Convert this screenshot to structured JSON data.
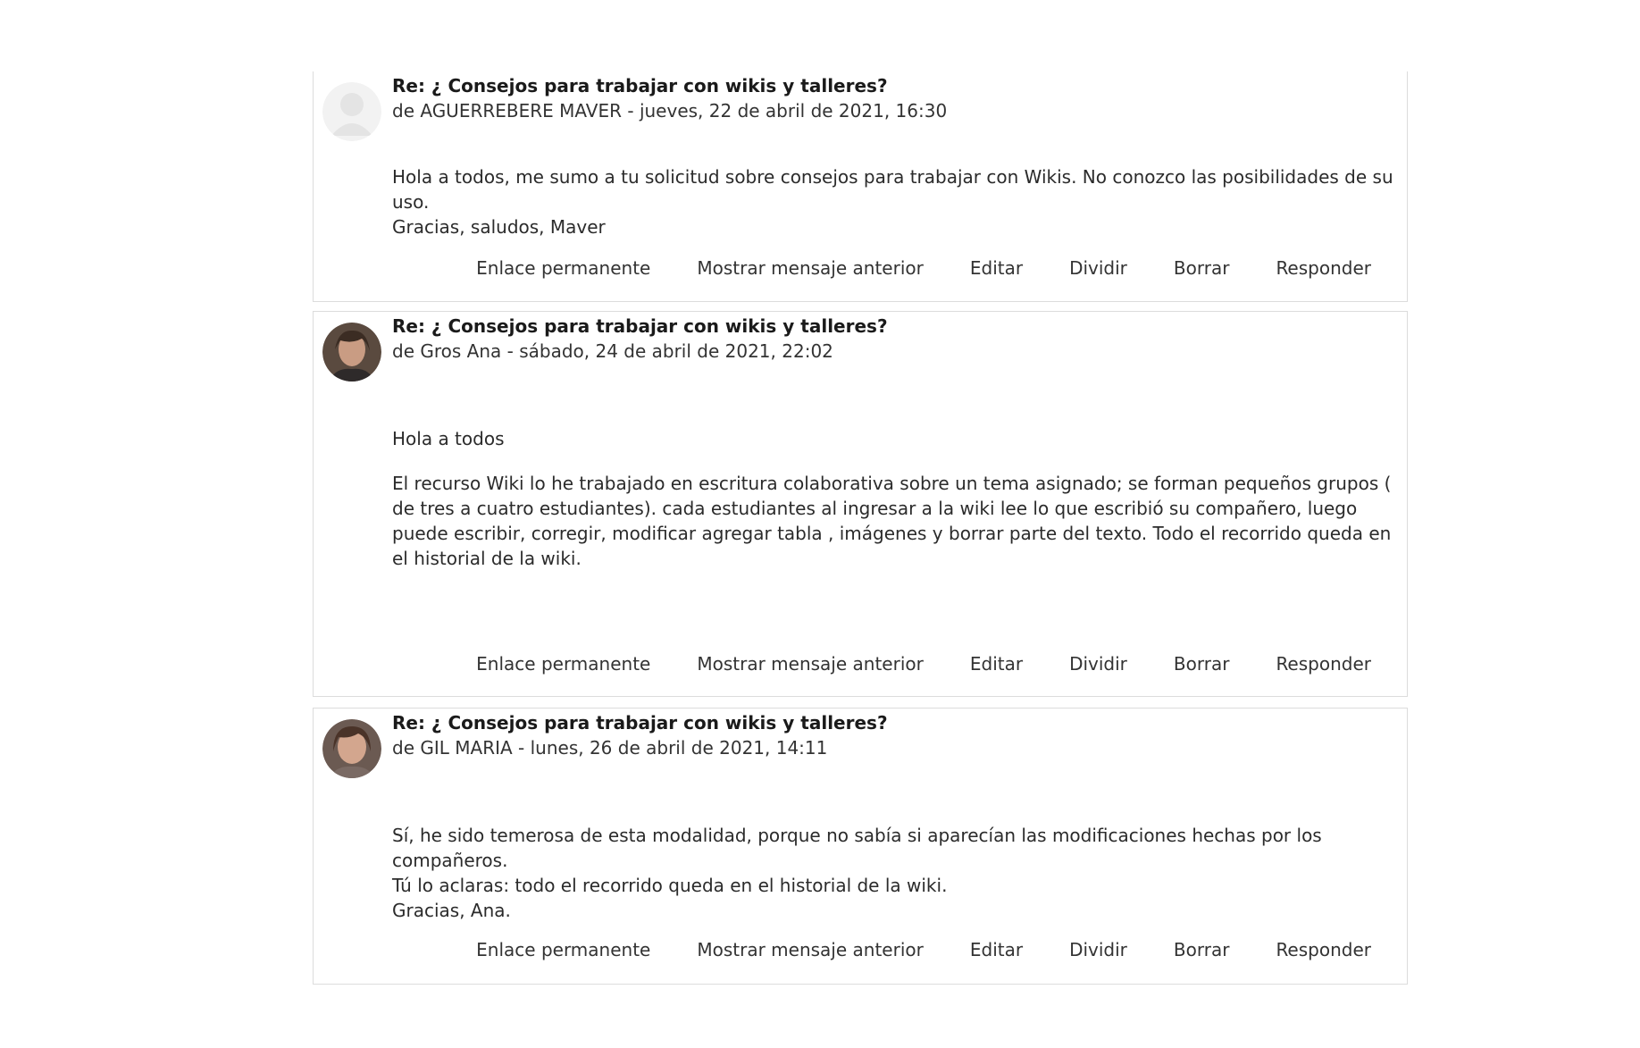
{
  "posts": [
    {
      "subject": "Re: ¿ Consejos para trabajar con wikis y talleres?",
      "byline": "de AGUERREBERE MAVER - jueves, 22 de abril de 2021, 16:30",
      "avatar": "default-user-avatar",
      "body": [
        "Hola a todos, me sumo a tu solicitud sobre consejos para trabajar con Wikis. No conozco las posibilidades de su uso.",
        "Gracias, saludos, Maver"
      ]
    },
    {
      "subject": "Re: ¿ Consejos para trabajar con wikis y talleres?",
      "byline": "de Gros Ana - sábado, 24 de abril de 2021, 22:02",
      "avatar": "user-photo-avatar",
      "body": [
        "Hola a todos",
        "El recurso Wiki lo he trabajado en escritura colaborativa sobre un tema asignado; se forman pequeños grupos ( de tres a cuatro estudiantes). cada estudiantes al  ingresar a la wiki lee lo que escribió su compañero, luego  puede escribir,  corregir,  modificar agregar tabla , imágenes  y  borrar parte del texto. Todo  el recorrido queda en el historial de la wiki."
      ]
    },
    {
      "subject": "Re: ¿ Consejos para trabajar con wikis y talleres?",
      "byline": "de GIL MARIA - lunes, 26 de abril de 2021, 14:11",
      "avatar": "user-photo-avatar",
      "body": [
        "Sí, he sido temerosa de esta modalidad, porque no sabía si aparecían las modificaciones hechas por los compañeros.",
        "Tú lo aclaras: todo el recorrido queda en el historial de la wiki.",
        "Gracias, Ana."
      ]
    }
  ],
  "commands": {
    "permalink": "Enlace permanente",
    "show_parent": "Mostrar mensaje anterior",
    "edit": "Editar",
    "split": "Dividir",
    "delete": "Borrar",
    "reply": "Responder"
  }
}
